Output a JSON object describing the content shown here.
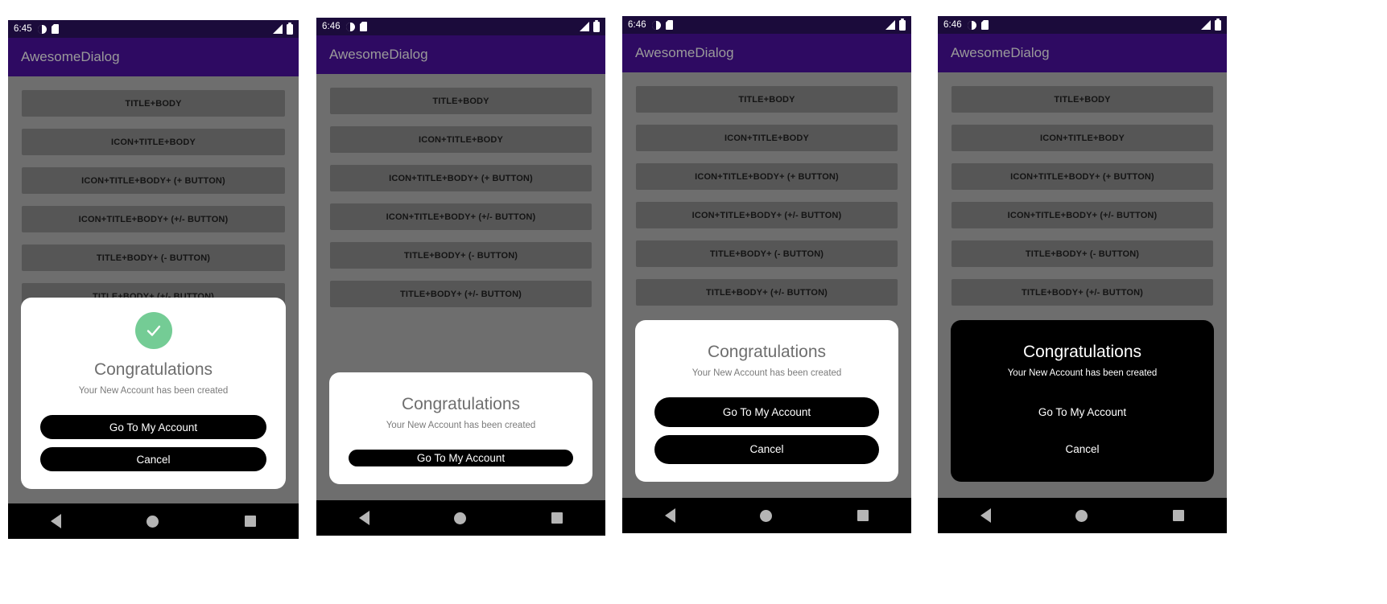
{
  "app": {
    "title": "AwesomeDialog"
  },
  "option_buttons": [
    "TITLE+BODY",
    "ICON+TITLE+BODY",
    "ICON+TITLE+BODY+ (+ BUTTON)",
    "ICON+TITLE+BODY+ (+/- BUTTON)",
    "TITLE+BODY+ (- BUTTON)",
    "TITLE+BODY+ (+/- BUTTON)"
  ],
  "dialog": {
    "title": "Congratulations",
    "body": "Your New Account has been created",
    "primary_button": "Go To My Account",
    "secondary_button": "Cancel",
    "check_icon": "check-icon",
    "accent_green": "#74cc95"
  },
  "navbar": {
    "back": "back-triangle-icon",
    "home": "home-circle-icon",
    "recents": "recents-square-icon"
  },
  "statusbar": {
    "icons_left": [
      "clock-icon",
      "sd-card-icon"
    ],
    "icons_right": [
      "signal-icon",
      "battery-icon"
    ]
  },
  "panels": [
    {
      "id": "panel-1",
      "time": "6:45",
      "theme": "light",
      "has_check_icon": true,
      "buttons_visible": 4,
      "dialog_buttons": [
        "Go To My Account",
        "Cancel"
      ]
    },
    {
      "id": "panel-2",
      "time": "6:46",
      "theme": "light",
      "has_check_icon": false,
      "buttons_visible": 6,
      "dialog_buttons": [
        "Go To My Account"
      ]
    },
    {
      "id": "panel-3",
      "time": "6:46",
      "theme": "light",
      "has_check_icon": false,
      "buttons_visible": 5,
      "dialog_buttons": [
        "Go To My Account",
        "Cancel"
      ]
    },
    {
      "id": "panel-4",
      "time": "6:46",
      "theme": "dark",
      "has_check_icon": false,
      "buttons_visible": 5,
      "dialog_buttons": [
        "Go To My Account",
        "Cancel"
      ]
    }
  ],
  "theme": {
    "appbar_bg": "#2e0a62",
    "statusbar_bg": "#1b0b3b",
    "screen_bg": "#6e6e6e",
    "option_btn_bg": "#565656",
    "navbar_bg": "#000000"
  }
}
